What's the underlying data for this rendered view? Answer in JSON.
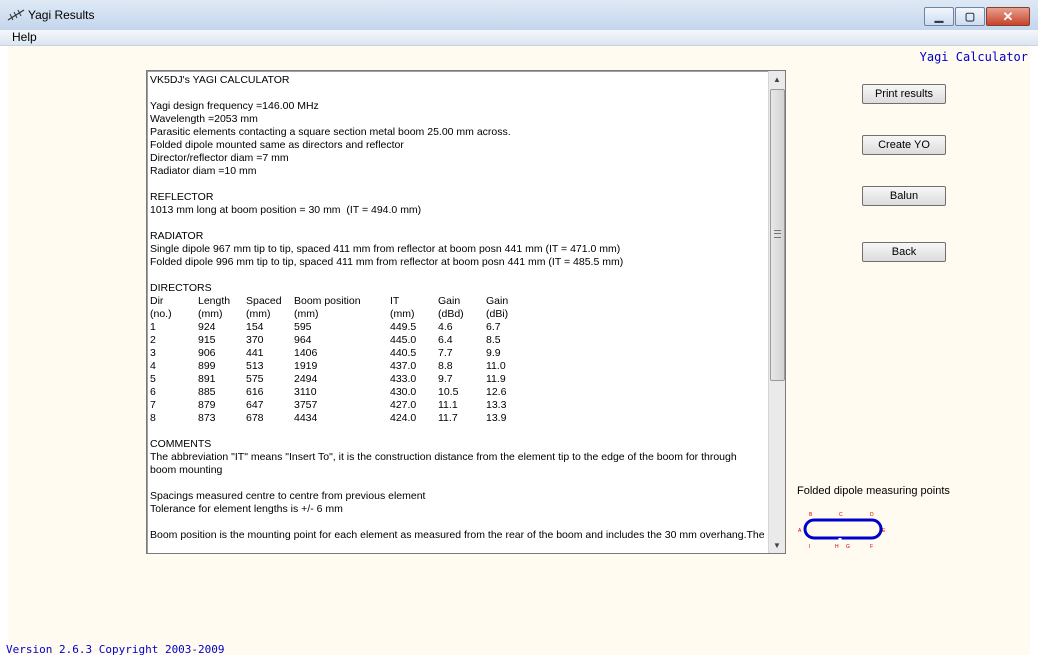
{
  "window": {
    "title": "Yagi Results",
    "minimize_glyph": "▁",
    "maximize_glyph": "▢",
    "close_glyph": "✕"
  },
  "menu": {
    "help": "Help"
  },
  "header": {
    "app_label": "Yagi Calculator"
  },
  "results_text": [
    "VK5DJ's YAGI CALCULATOR",
    "",
    "Yagi design frequency =146.00 MHz",
    "Wavelength =2053 mm",
    "Parasitic elements contacting a square section metal boom 25.00 mm across.",
    "Folded dipole mounted same as directors and reflector",
    "Director/reflector diam =7 mm",
    "Radiator diam =10 mm",
    "",
    "REFLECTOR",
    "1013 mm long at boom position = 30 mm  (IT = 494.0 mm)",
    "",
    "RADIATOR",
    "Single dipole 967 mm tip to tip, spaced 411 mm from reflector at boom posn 441 mm (IT = 471.0 mm)",
    "Folded dipole 996 mm tip to tip, spaced 411 mm from reflector at boom posn 441 mm (IT = 485.5 mm)",
    "",
    "DIRECTORS"
  ],
  "directors_table": {
    "headers": [
      [
        "Dir",
        "(no.)"
      ],
      [
        "Length",
        "(mm)"
      ],
      [
        "Spaced",
        "(mm)"
      ],
      [
        "Boom position",
        "(mm)"
      ],
      [
        "IT",
        "(mm)"
      ],
      [
        "Gain",
        "(dBd)"
      ],
      [
        "Gain",
        "(dBi)"
      ]
    ],
    "rows": [
      [
        "1",
        "924",
        "154",
        "595",
        "449.5",
        "4.6",
        "6.7"
      ],
      [
        "2",
        "915",
        "370",
        "964",
        "445.0",
        "6.4",
        "8.5"
      ],
      [
        "3",
        "906",
        "441",
        "1406",
        "440.5",
        "7.7",
        "9.9"
      ],
      [
        "4",
        "899",
        "513",
        "1919",
        "437.0",
        "8.8",
        "11.0"
      ],
      [
        "5",
        "891",
        "575",
        "2494",
        "433.0",
        "9.7",
        "11.9"
      ],
      [
        "6",
        "885",
        "616",
        "3110",
        "430.0",
        "10.5",
        "12.6"
      ],
      [
        "7",
        "879",
        "647",
        "3757",
        "427.0",
        "11.1",
        "13.3"
      ],
      [
        "8",
        "873",
        "678",
        "4434",
        "424.0",
        "11.7",
        "13.9"
      ]
    ]
  },
  "comments_text": [
    "",
    "COMMENTS",
    "The abbreviation \"IT\" means \"Insert To\", it is the construction distance from the element tip to the edge of the boom for through",
    "boom mounting",
    "",
    "Spacings measured centre to centre from previous element",
    "Tolerance for element lengths is +/- 6 mm",
    "",
    "Boom position is the mounting point for each element as measured from the rear of the boom and includes the 30 mm overhang.The"
  ],
  "buttons": {
    "print": "Print results",
    "create_yo": "Create YO",
    "balun": "Balun",
    "back": "Back"
  },
  "folded_dipole": {
    "label": "Folded dipole measuring points",
    "points": [
      "A",
      "B",
      "C",
      "D",
      "E",
      "F",
      "G",
      "H",
      "I"
    ]
  },
  "status": {
    "version": "Version 2.6.3 Copyright 2003-2009"
  },
  "colors": {
    "client_bg": "#fffbf0",
    "accent_blue": "#0000cc",
    "dipole_red": "#cc0000"
  }
}
